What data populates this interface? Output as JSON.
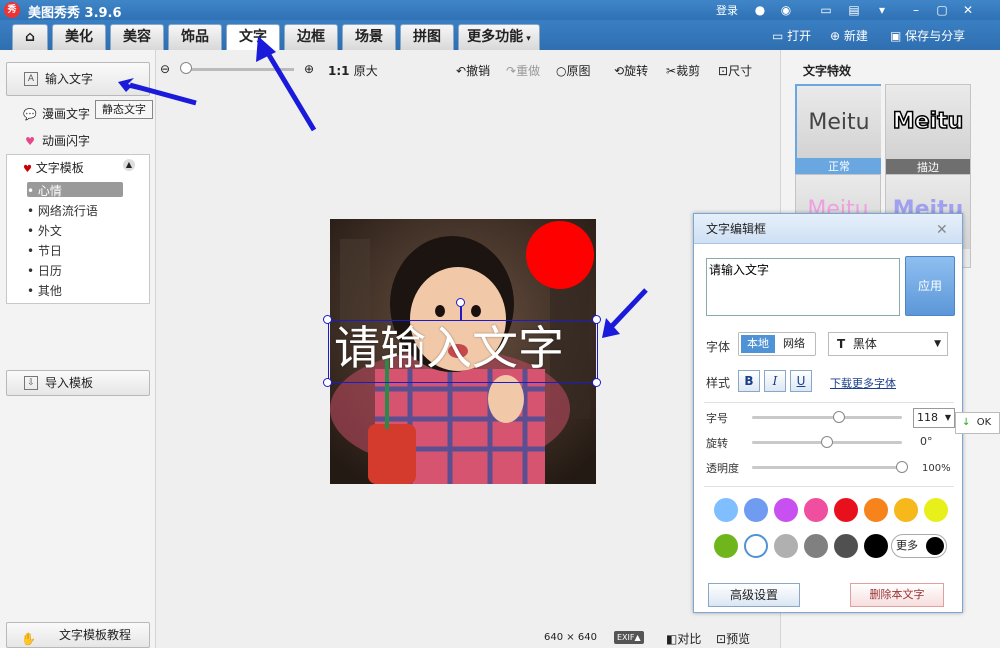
{
  "app": {
    "title": "美图秀秀 3.9.6",
    "logo": "秀",
    "login": "登录"
  },
  "tabs": [
    "美化",
    "美容",
    "饰品",
    "文字",
    "边框",
    "场景",
    "拼图",
    "更多功能"
  ],
  "active_tab": "文字",
  "header_tools": {
    "open": "打开",
    "new": "新建",
    "save_share": "保存与分享"
  },
  "left": {
    "input_text": "输入文字",
    "tooltip_static": "静态文字",
    "comic_text": "漫画文字",
    "anim_text": "动画闪字",
    "template_header": "文字模板",
    "templates": [
      "心情",
      "网络流行语",
      "外文",
      "节日",
      "日历",
      "其他"
    ],
    "selected_template": "心情",
    "import_template": "导入模板",
    "tutorial": "文字模板教程"
  },
  "toolbar": {
    "zoom_label": "1:1",
    "original_size": "原大",
    "undo": "撤销",
    "redo": "重做",
    "original": "原图",
    "rotate": "旋转",
    "crop": "裁剪",
    "size": "尺寸"
  },
  "canvas": {
    "overlay_text": "请输入文字",
    "dims_w": "640",
    "dims_x": "×",
    "dims_h": "640",
    "exif": "EXIF▲",
    "compare": "对比",
    "preview": "预览"
  },
  "effects": {
    "title": "文字特效",
    "items": [
      {
        "sample": "Meitu",
        "label": "正常"
      },
      {
        "sample": "Meitu",
        "label": "描边"
      }
    ],
    "partial": [
      "Meitu",
      "Meitu"
    ]
  },
  "dialog": {
    "title": "文字编辑框",
    "text_value": "请输入文字",
    "apply": "应用",
    "font_label": "字体",
    "font_local": "本地",
    "font_network": "网络",
    "font_icon": "T",
    "font_name": "黑体",
    "style_label": "样式",
    "bold": "B",
    "italic": "I",
    "underline": "U",
    "download_fonts": "下载更多字体",
    "size_label": "字号",
    "size_value": "118",
    "rotate_label": "旋转",
    "rotate_value": "0°",
    "opacity_label": "透明度",
    "opacity_value": "100%",
    "more_colors": "更多",
    "advanced": "高级设置",
    "delete_text": "删除本文字",
    "ok": "OK"
  },
  "colors": {
    "swatches_row1": [
      "#7fbfff",
      "#6f9cf0",
      "#c84ff0",
      "#f04fa0",
      "#e8101c",
      "#f7831c",
      "#f7b81c",
      "#e8f01c"
    ],
    "swatches_row2": [
      "#6fb51c",
      "#ffffff",
      "#b0b0b0",
      "#808080",
      "#505050",
      "#000000"
    ],
    "titlebar": "#3479bd",
    "accent": "#3a7fc3"
  },
  "slider_levels": {
    "size": 0.58,
    "rotate": 0.5,
    "opacity": 1.0
  },
  "icons": [
    "home-icon",
    "open-folder-icon",
    "new-plus-icon",
    "save-icon",
    "undo-icon",
    "redo-icon",
    "rotate-icon",
    "crop-icon",
    "size-icon",
    "zoom-out-icon",
    "zoom-in-icon",
    "close-icon",
    "chevron-down-icon",
    "compare-icon",
    "preview-icon"
  ]
}
